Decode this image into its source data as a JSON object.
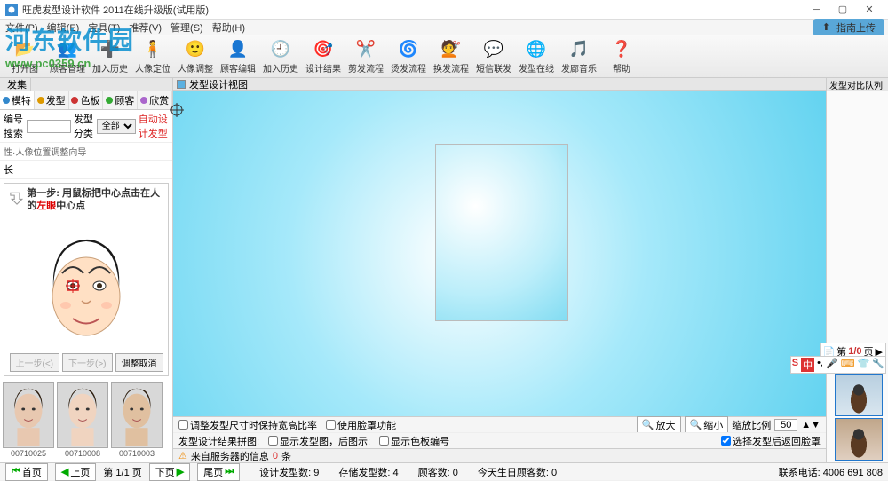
{
  "window": {
    "title": "旺虎发型设计软件 2011在线升级版(试用版)"
  },
  "menu": {
    "items": [
      "文件(P)",
      "编辑(E)",
      "宝具(T)",
      "推荐(V)",
      "管理(S)",
      "帮助(H)"
    ],
    "upload": "指南上传"
  },
  "toolbar": {
    "items": [
      {
        "label": "打开图",
        "icon": "📂",
        "color": "#d97a00"
      },
      {
        "label": "顾客管理",
        "icon": "👥",
        "color": "#0a68b0"
      },
      {
        "label": "加入历史",
        "icon": "➕",
        "color": "#2a9b2a"
      },
      {
        "label": "人像定位",
        "icon": "🧍",
        "color": "#c33"
      },
      {
        "label": "人像调整",
        "icon": "🙂",
        "color": "#b37a00"
      },
      {
        "label": "顾客编辑",
        "icon": "👤",
        "color": "#7a4a2a"
      },
      {
        "label": "加入历史",
        "icon": "🕘",
        "color": "#0077b0"
      },
      {
        "label": "设计结果",
        "icon": "🎯",
        "color": "#c33"
      },
      {
        "label": "剪发流程",
        "icon": "✂️",
        "color": ""
      },
      {
        "label": "烫发流程",
        "icon": "🌀",
        "color": "#c055c0"
      },
      {
        "label": "换发流程",
        "icon": "💇",
        "color": "#d28a00"
      },
      {
        "label": "短信联发",
        "icon": "💬",
        "color": "#b05a00"
      },
      {
        "label": "发型在线",
        "icon": "🌐",
        "color": "#0a7a0a"
      },
      {
        "label": "发廊音乐",
        "icon": "🎵",
        "color": "#2266cc"
      },
      {
        "label": "帮助",
        "icon": "❓",
        "color": "#2a9b2a"
      }
    ]
  },
  "watermark": {
    "logo": "河东软件园",
    "url": "www.pc0359.cn"
  },
  "left": {
    "header_tabs": [
      "发集"
    ],
    "tabs": [
      {
        "label": "模特",
        "dot": "#3388cc"
      },
      {
        "label": "发型",
        "dot": "#dd9900"
      },
      {
        "label": "色板",
        "dot": "#cc3333"
      },
      {
        "label": "顾客",
        "dot": "#33aa33"
      },
      {
        "label": "欣赏",
        "dot": "#aa66cc"
      }
    ],
    "active_tab": 0,
    "search_label": "编号搜索",
    "category_label": "发型分类",
    "category_value": "全部",
    "auto_design": "自动设计发型",
    "hint": "性·人像位置调整向导",
    "row2": "长",
    "wizard": {
      "step_label": "第一步:",
      "step_text_a": "用鼠标把中心点击在人的",
      "step_text_red": "左眼",
      "step_text_b": "中心点",
      "btn_prev": "上一步(<)",
      "btn_next": "下一步(>)",
      "btn_cancel": "调整取消"
    },
    "thumbs": [
      {
        "id": "00710025"
      },
      {
        "id": "00710008"
      },
      {
        "id": "00710003"
      }
    ]
  },
  "canvas": {
    "header": "发型设计视图",
    "opts1": {
      "keep_ratio": "调整发型尺寸时保持宽高比率",
      "use_mask": "使用脸罩功能"
    },
    "opts2": {
      "desc_label": "发型设计结果拼图:",
      "show_style": "显示发型图，后图示:",
      "show_color": "显示色板编号",
      "zoom_in": "放大",
      "zoom_out": "缩小",
      "zoom_ratio": "缩放比例",
      "zoom_value": "50",
      "save_return": "选择发型后返回脸罩"
    },
    "msg": {
      "label": "来自服务器的信息",
      "count": "0",
      "unit": "条"
    }
  },
  "right": {
    "header": "发型对比队列",
    "page_prefix": "第",
    "page_val": "1/0",
    "page_suffix": "页",
    "ime": "中"
  },
  "bottom": {
    "nav": {
      "first": "首页",
      "prev": "上页",
      "page": "第 1/1 页",
      "next": "下页",
      "last": "尾页"
    },
    "stats": {
      "designs": "设计发型数:",
      "designs_v": "9",
      "saved": "存储发型数:",
      "saved_v": "4",
      "customers": "顾客数:",
      "customers_v": "0",
      "birthday": "今天生日顾客数:",
      "birthday_v": "0"
    },
    "phone_label": "联系电话:",
    "phone": "4006 691 808"
  }
}
